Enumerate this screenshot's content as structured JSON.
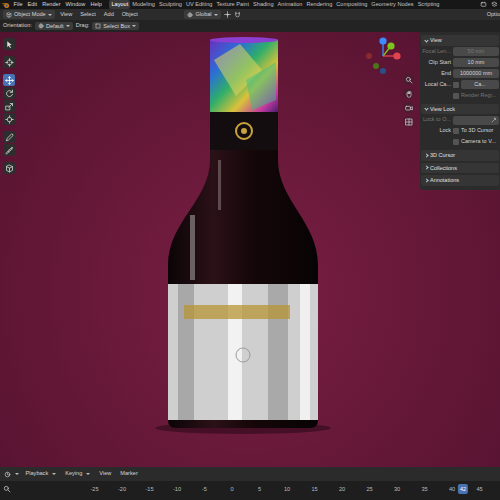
{
  "menu": [
    "File",
    "Edit",
    "Render",
    "Window",
    "Help"
  ],
  "workspaces": [
    {
      "label": "Layout",
      "selected": true
    },
    {
      "label": "Modeling",
      "selected": false
    },
    {
      "label": "Sculpting",
      "selected": false
    },
    {
      "label": "UV Editing",
      "selected": false
    },
    {
      "label": "Texture Paint",
      "selected": false
    },
    {
      "label": "Shading",
      "selected": false
    },
    {
      "label": "Animation",
      "selected": false
    },
    {
      "label": "Rendering",
      "selected": false
    },
    {
      "label": "Compositing",
      "selected": false
    },
    {
      "label": "Geometry Nodes",
      "selected": false
    },
    {
      "label": "Scripting",
      "selected": false
    }
  ],
  "header": {
    "mode": "Object Mode",
    "menus": [
      "View",
      "Select",
      "Add",
      "Object"
    ],
    "transform": "Global",
    "options": "Optio"
  },
  "tool_settings": {
    "orientation_label": "Orientation:",
    "orientation": "Default",
    "drag_label": "Drag:",
    "drag": "Select Box"
  },
  "toolbar": [
    {
      "selected": false
    },
    {
      "selected": false
    },
    {
      "selected": true
    },
    {
      "selected": false
    },
    {
      "selected": false
    },
    {
      "selected": false
    },
    {
      "selected": false
    },
    {
      "selected": false
    },
    {
      "selected": false
    }
  ],
  "sidebar": {
    "sections": [
      {
        "title": "View",
        "expanded": true,
        "rows": [
          {
            "kind": "field",
            "label": "Focal Len...",
            "value": "50 mm",
            "disabled": true
          },
          {
            "kind": "field",
            "label": "Clip Start",
            "value": "10 mm",
            "disabled": false
          },
          {
            "kind": "field",
            "label": "End",
            "value": "1000000 mm",
            "disabled": false
          },
          {
            "kind": "check-field",
            "label": "Local Ca...",
            "value": "Ca...",
            "checked": false,
            "disabled": false
          },
          {
            "kind": "check",
            "label": "Render Regi...",
            "checked": false,
            "disabled": true
          }
        ]
      },
      {
        "title": "View Lock",
        "expanded": true,
        "rows": [
          {
            "kind": "picker",
            "label": "Lock to O...",
            "disabled": true
          },
          {
            "kind": "check",
            "prefix": "Lock",
            "label": "To 3D Cursor",
            "checked": false,
            "disabled": false
          },
          {
            "kind": "check",
            "label": "Camera to V...",
            "checked": false,
            "disabled": false
          }
        ]
      },
      {
        "title": "3D Cursor",
        "expanded": false,
        "rows": []
      },
      {
        "title": "Collections",
        "expanded": false,
        "rows": []
      },
      {
        "title": "Annotations",
        "expanded": false,
        "rows": []
      }
    ]
  },
  "timeline": {
    "menus": [
      "Playback",
      "Keying",
      "View",
      "Marker"
    ],
    "ticks": [
      "-25",
      "-20",
      "-15",
      "-10",
      "-5",
      "0",
      "5",
      "10",
      "15",
      "20",
      "25",
      "30",
      "35",
      "40",
      "45"
    ],
    "current_frame": "42"
  }
}
